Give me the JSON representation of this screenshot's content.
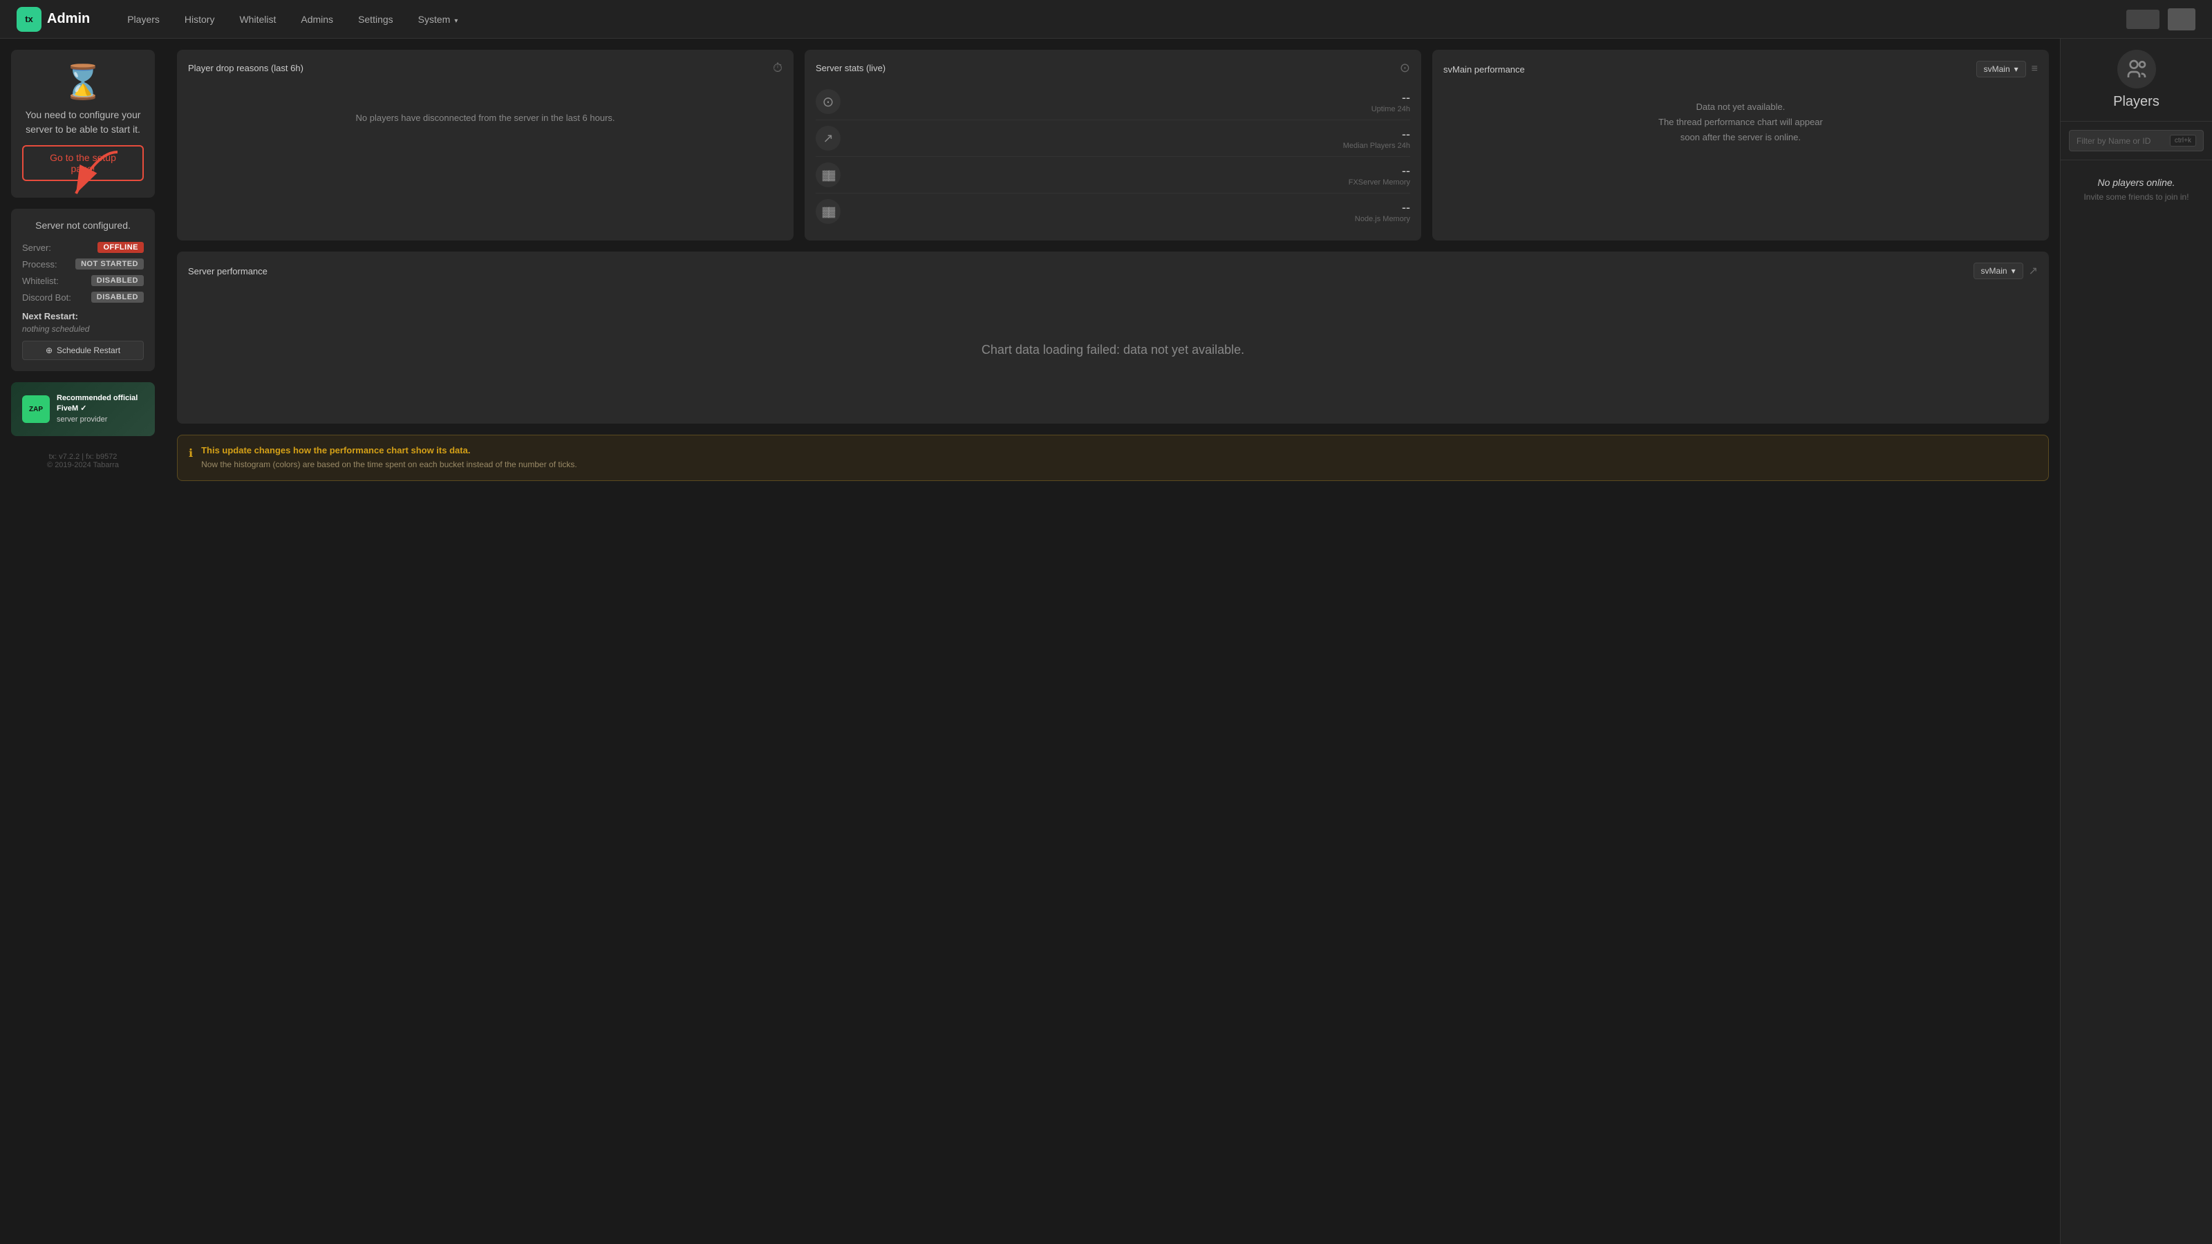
{
  "app": {
    "logo_text": "Admin",
    "logo_short": "tx"
  },
  "nav": {
    "links": [
      {
        "id": "players",
        "label": "Players",
        "active": false
      },
      {
        "id": "history",
        "label": "History",
        "active": false
      },
      {
        "id": "whitelist",
        "label": "Whitelist",
        "active": false
      },
      {
        "id": "admins",
        "label": "Admins",
        "active": false
      },
      {
        "id": "settings",
        "label": "Settings",
        "active": false
      },
      {
        "id": "system",
        "label": "System",
        "active": false,
        "dropdown": true
      }
    ]
  },
  "configure_card": {
    "text": "You need to configure your server to be able to start it.",
    "button_label": "Go to the setup page!"
  },
  "server_status": {
    "title": "Server not configured.",
    "server_label": "Server:",
    "server_value": "OFFLINE",
    "process_label": "Process:",
    "process_value": "NOT STARTED",
    "whitelist_label": "Whitelist:",
    "whitelist_value": "DISABLED",
    "discord_label": "Discord Bot:",
    "discord_value": "DISABLED",
    "next_restart_label": "Next Restart:",
    "next_restart_value": "nothing scheduled",
    "schedule_btn": "Schedule Restart"
  },
  "zap": {
    "text": "Recommended official FiveM ✓",
    "subtext": "server provider",
    "logo": "ZAP"
  },
  "version": {
    "tx": "tx: v7.2.2 | fx: b9572",
    "copy": "© 2019-2024 Tabarra"
  },
  "player_drop": {
    "title": "Player drop reasons (last 6h)",
    "empty_msg": "No players have disconnected from the server in the last 6 hours."
  },
  "server_stats": {
    "title": "Server stats (live)",
    "uptime_value": "--",
    "uptime_label": "Uptime 24h",
    "median_value": "--",
    "median_label": "Median Players 24h",
    "fxmem_value": "--",
    "fxmem_label": "FXServer Memory",
    "nodemem_value": "--",
    "nodemem_label": "Node.js Memory"
  },
  "svmain_perf": {
    "title": "svMain performance",
    "dropdown_value": "svMain",
    "not_available_line1": "Data not yet available.",
    "not_available_line2": "The thread performance chart will appear",
    "not_available_line3": "soon after the server is online."
  },
  "server_perf": {
    "title": "Server performance",
    "dropdown_value": "svMain",
    "chart_fail": "Chart data loading failed: data not yet available."
  },
  "update_notice": {
    "title": "This update changes how the performance chart show its data.",
    "body": "Now the histogram (colors) are based on the time spent on each bucket instead of the number of ticks."
  },
  "sidebar": {
    "players_title": "Players",
    "search_placeholder": "Filter by Name or ID",
    "search_shortcut": "ctrl+k",
    "no_players_title": "No players online.",
    "no_players_sub": "Invite some friends to join in!"
  }
}
